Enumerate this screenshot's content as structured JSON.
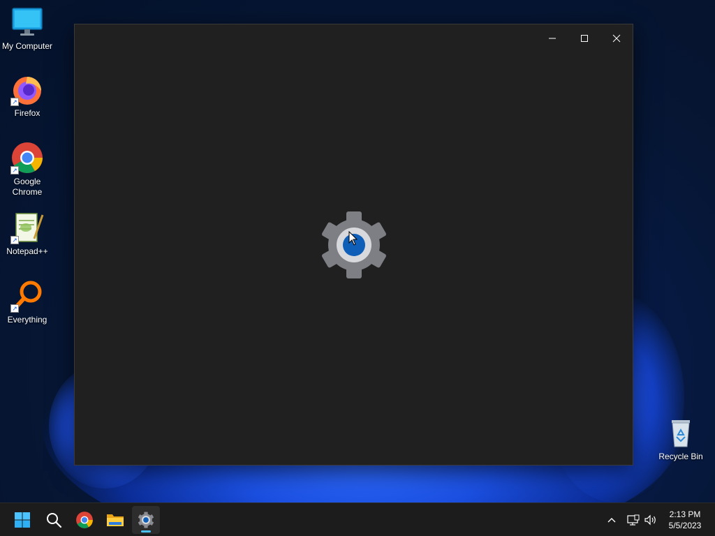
{
  "desktop": {
    "icons": [
      {
        "label": "My Computer",
        "icon": "monitor-icon"
      },
      {
        "label": "Firefox",
        "icon": "firefox-icon"
      },
      {
        "label": "Google Chrome",
        "icon": "chrome-icon"
      },
      {
        "label": "Notepad++",
        "icon": "notepadpp-icon"
      },
      {
        "label": "Everything",
        "icon": "everything-search-icon"
      }
    ],
    "recycle_bin": {
      "label": "Recycle Bin",
      "icon": "recycle-bin-icon"
    }
  },
  "window": {
    "app": "Settings",
    "controls": {
      "minimize": "minimize-icon",
      "maximize": "maximize-icon",
      "close": "close-icon"
    },
    "splash_icon": "settings-gear-icon"
  },
  "taskbar": {
    "pinned": [
      {
        "name": "start",
        "icon": "windows-start-icon"
      },
      {
        "name": "search",
        "icon": "search-icon"
      },
      {
        "name": "chrome",
        "icon": "chrome-icon"
      },
      {
        "name": "file-explorer",
        "icon": "folder-icon"
      },
      {
        "name": "settings",
        "icon": "settings-gear-icon",
        "active": true
      }
    ],
    "tray": {
      "icons": [
        "chevron-up-icon",
        "network-icon",
        "volume-icon"
      ]
    },
    "clock": {
      "time": "2:13 PM",
      "date": "5/5/2023"
    }
  },
  "colors": {
    "accent": "#4cc2ff",
    "window_bg": "#202020",
    "taskbar_bg": "#1c1c1c"
  }
}
